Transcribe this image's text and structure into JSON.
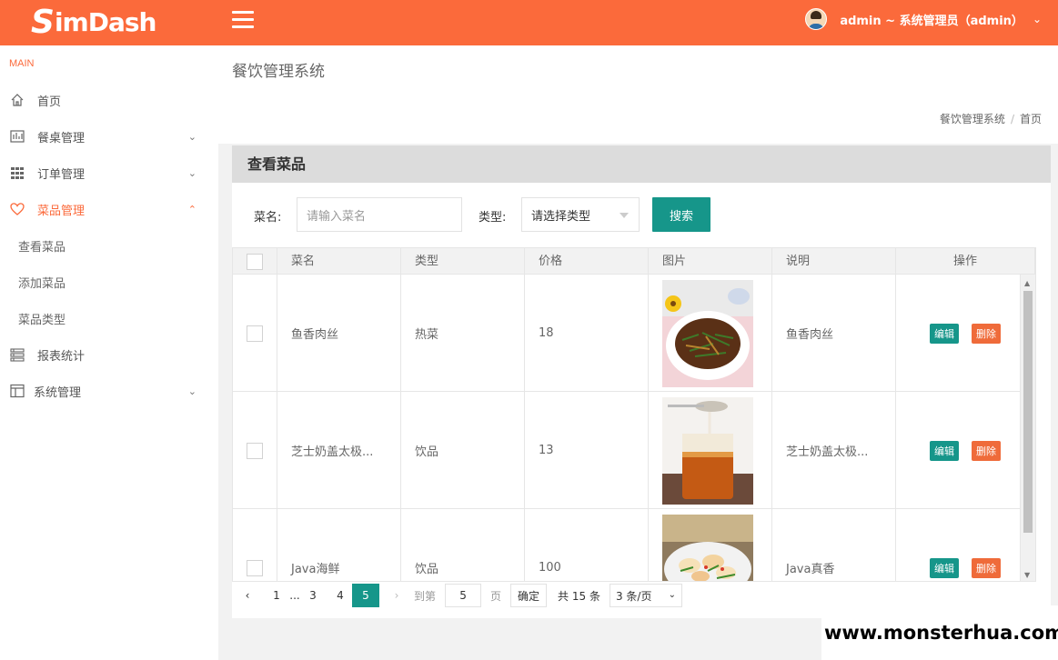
{
  "header": {
    "logo_prefix": "S",
    "logo_rest": "imDash",
    "user_label": "admin ~ 系统管理员（admin）"
  },
  "sidebar": {
    "section_label": "MAIN",
    "items": [
      {
        "label": "首页",
        "icon": "home-icon"
      },
      {
        "label": "餐桌管理",
        "icon": "table-icon"
      },
      {
        "label": "订单管理",
        "icon": "grid-icon"
      },
      {
        "label": "菜品管理",
        "icon": "heart-icon"
      },
      {
        "label": "报表统计",
        "icon": "list-icon"
      },
      {
        "label": "系统管理",
        "icon": "layout-icon"
      }
    ],
    "sub_items": [
      "查看菜品",
      "添加菜品",
      "菜品类型"
    ]
  },
  "content": {
    "page_title": "餐饮管理系统",
    "breadcrumb": [
      "餐饮管理系统",
      "首页"
    ],
    "panel_title": "查看菜品",
    "search": {
      "name_label": "菜名:",
      "name_placeholder": "请输入菜名",
      "type_label": "类型:",
      "type_selected": "请选择类型",
      "button": "搜索"
    },
    "table": {
      "headers": [
        "菜名",
        "类型",
        "价格",
        "图片",
        "说明",
        "操作"
      ],
      "rows": [
        {
          "name": "鱼香肉丝",
          "type": "热菜",
          "price": "18",
          "desc": "鱼香肉丝"
        },
        {
          "name": "芝士奶盖太极...",
          "type": "饮品",
          "price": "13",
          "desc": "芝士奶盖太极..."
        },
        {
          "name": "Java海鲜",
          "type": "饮品",
          "price": "100",
          "desc": "Java真香"
        }
      ],
      "edit_label": "编辑",
      "delete_label": "删除"
    },
    "pagination": {
      "pages": [
        "1",
        "...",
        "3",
        "4",
        "5"
      ],
      "current": "5",
      "goto_label": "到第",
      "goto_value": "5",
      "page_unit": "页",
      "confirm": "确定",
      "total": "共 15 条",
      "page_size": "3 条/页"
    }
  },
  "watermark": "www.monsterhua.com",
  "colors": {
    "brand": "#fb6a3b",
    "teal": "#16968a",
    "delete": "#ef6b3a"
  }
}
